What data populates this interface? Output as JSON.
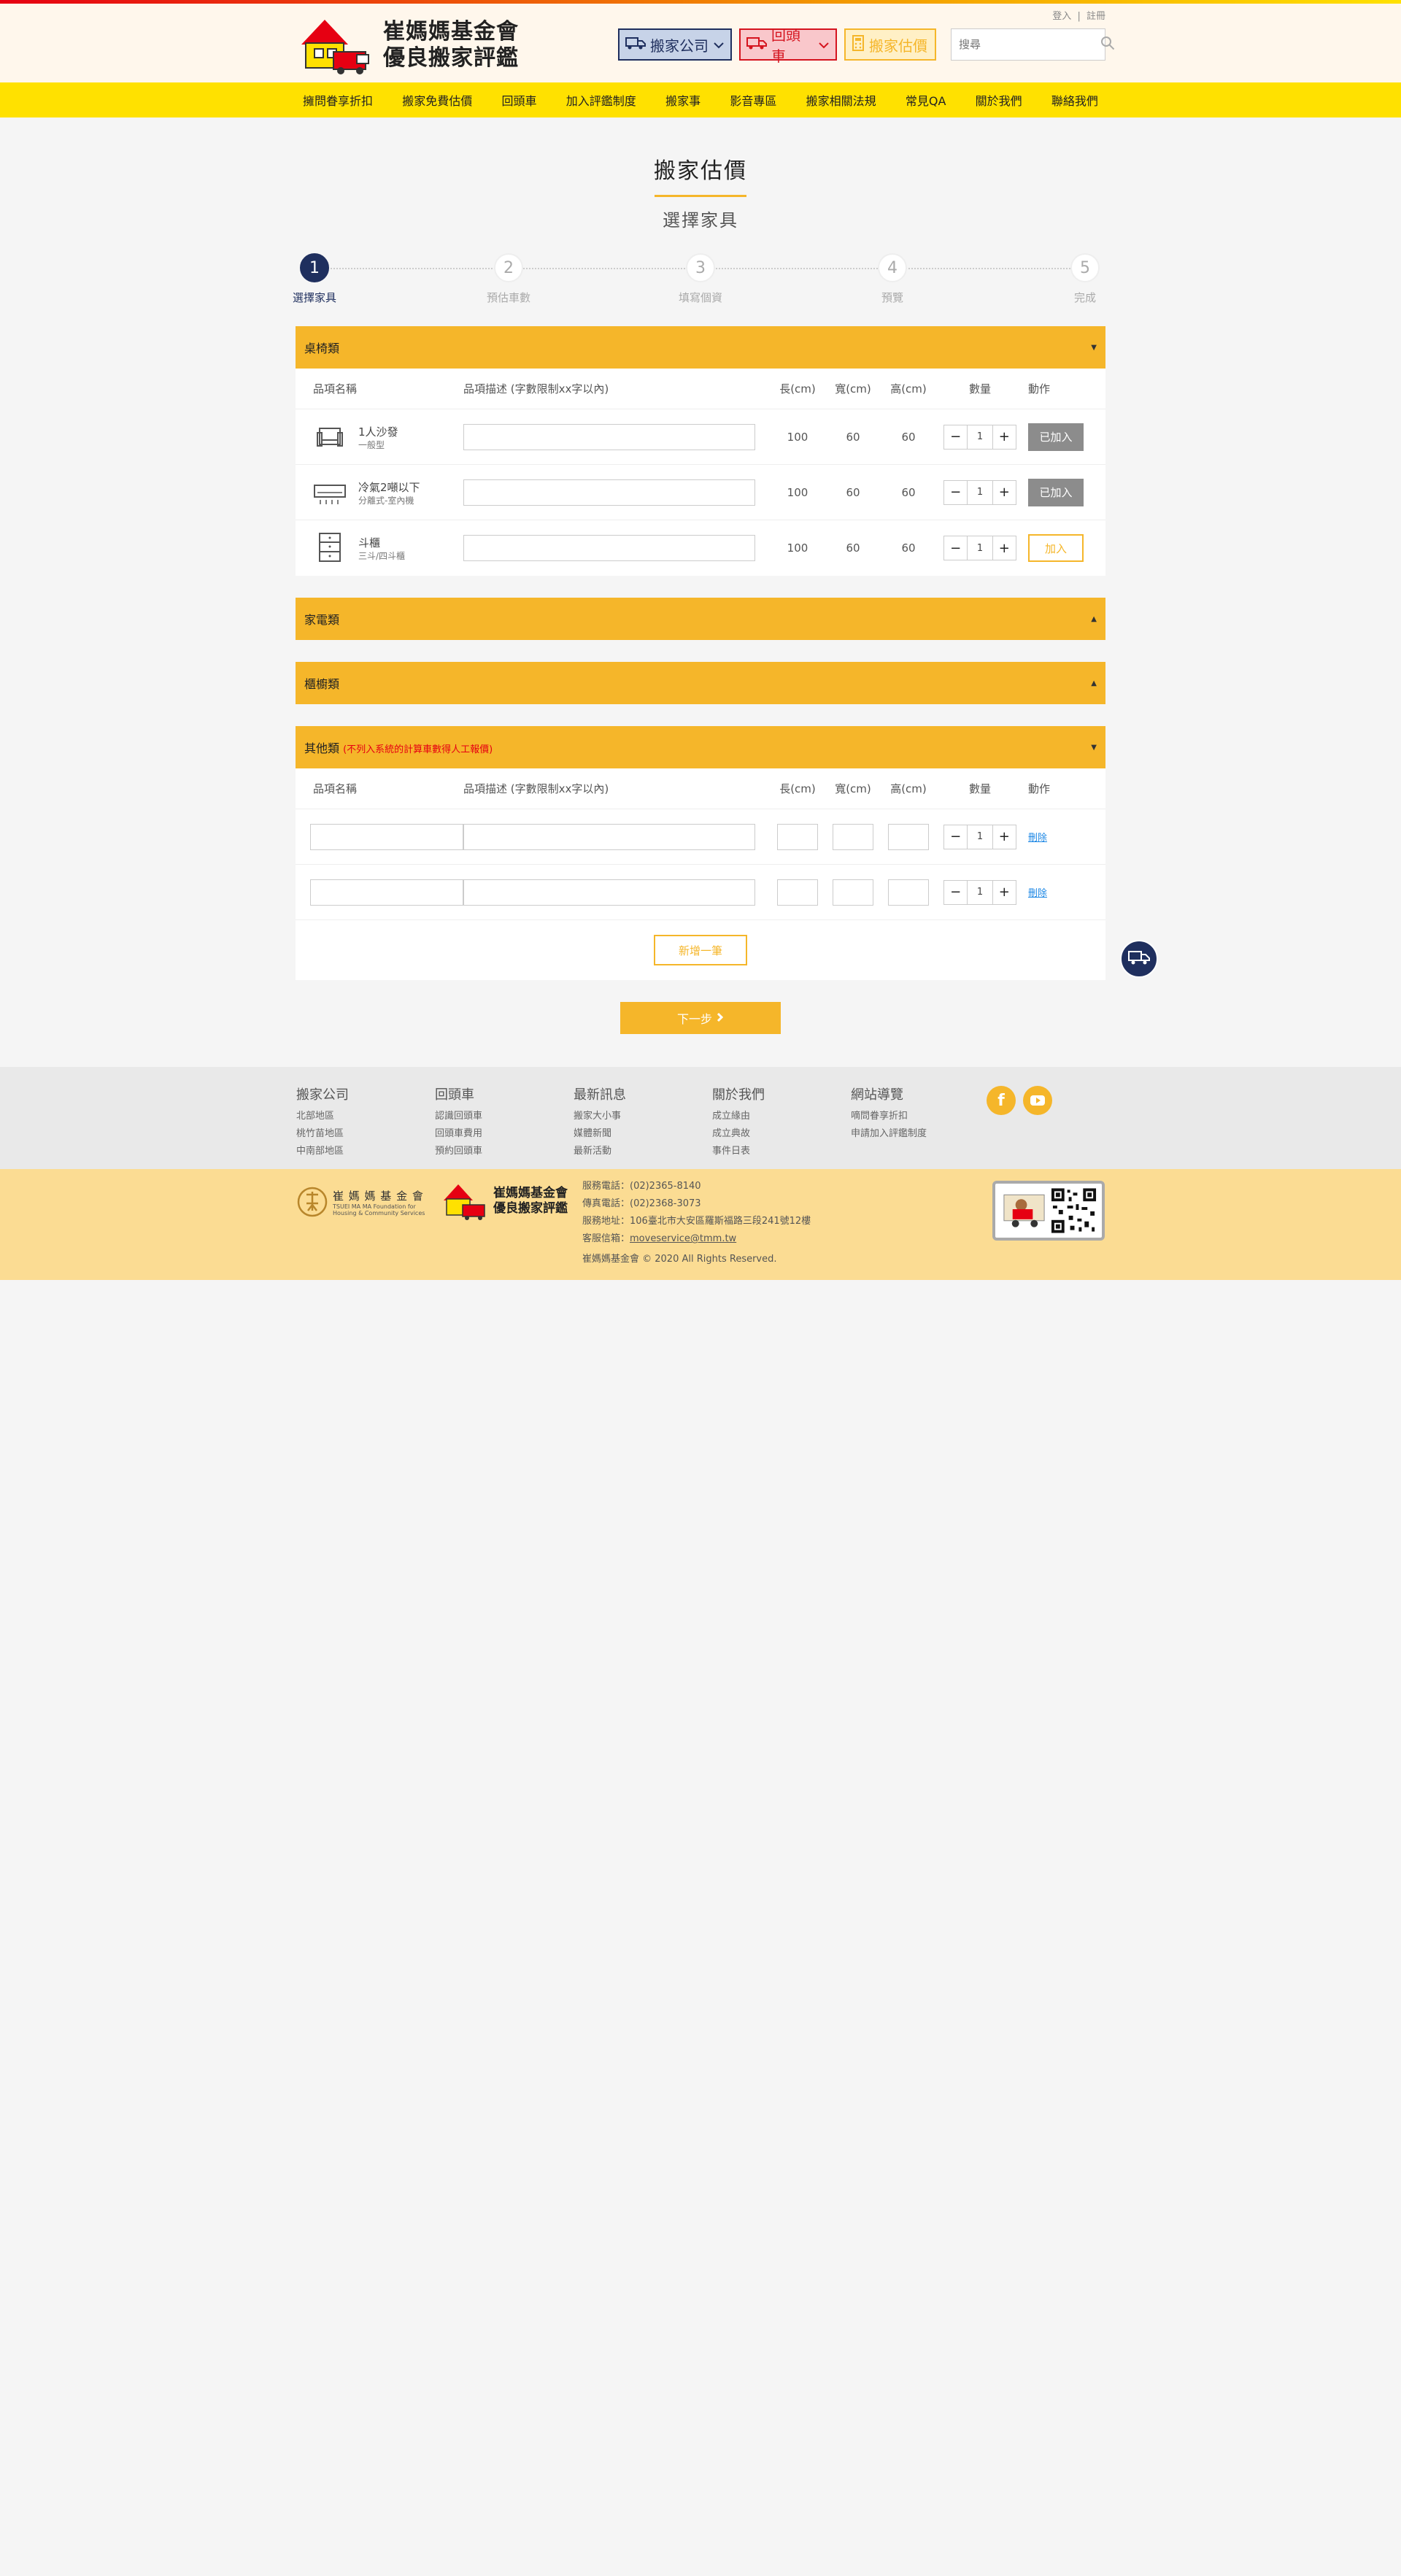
{
  "header": {
    "logo_line1": "崔媽媽基金會",
    "logo_line2": "優良搬家評鑑",
    "login": "登入",
    "sep": "|",
    "register": "註冊",
    "btn_company": "搬家公司",
    "btn_return": "回頭車",
    "btn_estimate": "搬家估價",
    "search_placeholder": "搜尋"
  },
  "nav": [
    "擁問眷享折扣",
    "搬家免費估價",
    "回頭車",
    "加入評鑑制度",
    "搬家事",
    "影音專區",
    "搬家相關法規",
    "常見QA",
    "關於我們",
    "聯絡我們"
  ],
  "page": {
    "title": "搬家估價",
    "subtitle": "選擇家具"
  },
  "steps": [
    {
      "num": "1",
      "label": "選擇家具"
    },
    {
      "num": "2",
      "label": "預估車數"
    },
    {
      "num": "3",
      "label": "填寫個資"
    },
    {
      "num": "4",
      "label": "預覽"
    },
    {
      "num": "5",
      "label": "完成"
    }
  ],
  "table_headers": {
    "name": "品項名稱",
    "desc": "品項描述 (字數限制xx字以內)",
    "length": "長(cm)",
    "width": "寬(cm)",
    "height": "高(cm)",
    "qty": "數量",
    "action": "動作"
  },
  "categories": {
    "table": {
      "name": "桌椅類"
    },
    "appliance": {
      "name": "家電類"
    },
    "cabinet": {
      "name": "櫃櫥類"
    },
    "other": {
      "name": "其他類",
      "note": "(不列入系統的計算車數得人工報價)"
    }
  },
  "items": [
    {
      "name": "1人沙發",
      "sub": "一般型",
      "l": "100",
      "w": "60",
      "h": "60",
      "qty": "1",
      "action": "已加入"
    },
    {
      "name": "冷氣2噸以下",
      "sub": "分離式-室內機",
      "l": "100",
      "w": "60",
      "h": "60",
      "qty": "1",
      "action": "已加入"
    },
    {
      "name": "斗櫃",
      "sub": "三斗/四斗櫃",
      "l": "100",
      "w": "60",
      "h": "60",
      "qty": "1",
      "action": "加入"
    }
  ],
  "other_rows": [
    {
      "qty": "1",
      "action": "刪除"
    },
    {
      "qty": "1",
      "action": "刪除"
    }
  ],
  "buttons": {
    "add_more": "新增一筆",
    "next": "下一步"
  },
  "footer": {
    "cols": [
      {
        "title": "搬家公司",
        "links": [
          "北部地區",
          "桃竹苗地區",
          "中南部地區"
        ]
      },
      {
        "title": "回頭車",
        "links": [
          "認識回頭車",
          "回頭車費用",
          "預約回頭車"
        ]
      },
      {
        "title": "最新訊息",
        "links": [
          "搬家大小事",
          "媒體新聞",
          "最新活動"
        ]
      },
      {
        "title": "關於我們",
        "links": [
          "成立緣由",
          "成立典故",
          "事件日表"
        ]
      },
      {
        "title": "網站導覽",
        "links": [
          "嘀問眷享折扣",
          "申請加入評鑑制度"
        ]
      }
    ],
    "foundation_name": "崔 媽 媽 基 金 會",
    "foundation_en1": "TSUEI MA MA Foundation for",
    "foundation_en2": "Housing & Community Services",
    "logo2_line1": "崔媽媽基金會",
    "logo2_line2": "優良搬家評鑑",
    "phone": "服務電話：(02)2365-8140",
    "fax": "傳真電話：(02)2368-3073",
    "address": "服務地址：106臺北市大安區羅斯福路三段241號12樓",
    "mail_label": "客服信箱：",
    "mail": "moveservice@tmm.tw",
    "copyright": "崔媽媽基金會 © 2020 All Rights Reserved."
  },
  "colors": {
    "accent": "#f5b62a",
    "nav": "#ffe100",
    "navy": "#1f2f5e",
    "red": "#e60012"
  }
}
